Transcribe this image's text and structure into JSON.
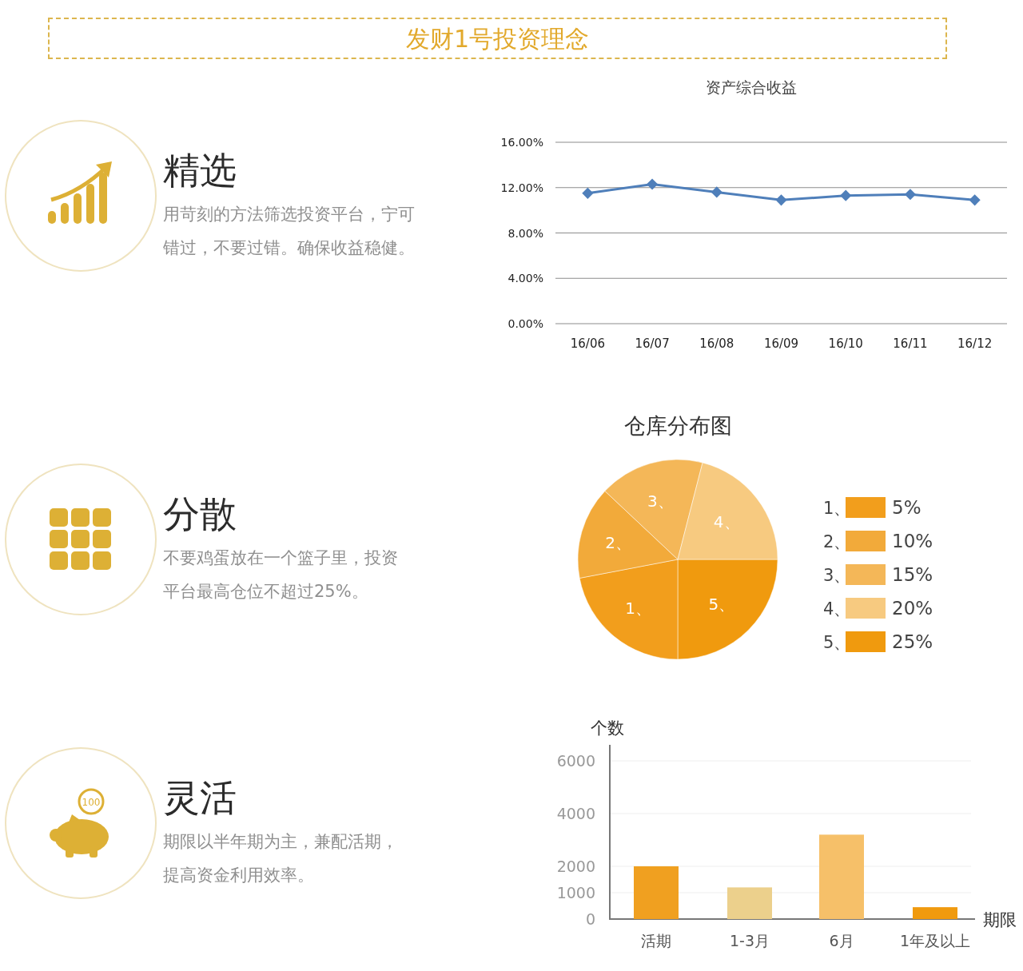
{
  "header": {
    "title": "发财1号投资理念"
  },
  "sections": [
    {
      "title": "精选",
      "description_lines": [
        "用苛刻的方法筛选投资平台，宁可",
        "错过，不要过错。确保收益稳健。"
      ],
      "chart_data": {
        "type": "line",
        "title": "资产综合收益",
        "categories": [
          "16/06",
          "16/07",
          "16/08",
          "16/09",
          "16/10",
          "16/11",
          "16/12"
        ],
        "series": [
          {
            "color": "#4f7fba",
            "marker": "diamond",
            "values": [
              11.5,
              12.3,
              11.6,
              10.9,
              11.3,
              11.4,
              10.9
            ]
          }
        ],
        "grid": true,
        "ylim": [
          0,
          16
        ],
        "yticks": [
          {
            "value": 0,
            "label": "0.00%"
          },
          {
            "value": 4,
            "label": "4.00%"
          },
          {
            "value": 8,
            "label": "8.00%"
          },
          {
            "value": 12,
            "label": "12.00%"
          },
          {
            "value": 16,
            "label": "16.00%"
          }
        ]
      }
    },
    {
      "title": "分散",
      "description_lines": [
        "不要鸡蛋放在一个篮子里，投资",
        "平台最高仓位不超过25%。"
      ],
      "chart_data": {
        "type": "pie",
        "title": "仓库分布图",
        "values": [
          22,
          15,
          17,
          21,
          25
        ]
      },
      "slice_labels": [
        "1、",
        "2、",
        "3、",
        "4、",
        "5、"
      ],
      "legend": [
        {
          "marker": "1、",
          "label": "5%",
          "color": "#f29e1c"
        },
        {
          "marker": "2、",
          "label": "10%",
          "color": "#f2aa3a"
        },
        {
          "marker": "3、",
          "label": "15%",
          "color": "#f4b758"
        },
        {
          "marker": "4、",
          "label": "20%",
          "color": "#f7ca80"
        },
        {
          "marker": "5、",
          "label": "25%",
          "color": "#f09a0e"
        }
      ]
    },
    {
      "icon_text": "100",
      "title": "灵活",
      "description_lines": [
        "期限以半年期为主，兼配活期，",
        "提高资金利用效率。"
      ],
      "chart_data": {
        "type": "bar",
        "ylabel": "个数",
        "xlabel": "期限",
        "categories": [
          "活期",
          "1-3月",
          "6月",
          "1年及以上"
        ],
        "series": [
          {
            "values": [
              2000,
              1200,
              3200,
              450
            ]
          }
        ],
        "colors": [
          "#f0a020",
          "#ecd08c",
          "#f6c069",
          "#f09a0e"
        ],
        "grid": true,
        "ylim": [
          0,
          6000
        ],
        "yticks": [
          0,
          1000,
          2000,
          4000,
          6000
        ]
      }
    }
  ]
}
